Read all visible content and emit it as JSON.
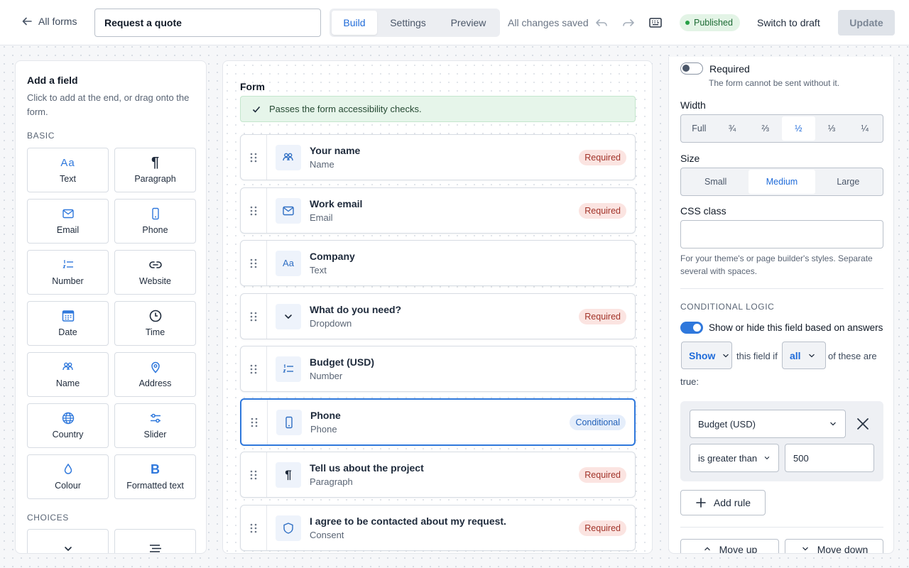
{
  "header": {
    "back_label": "All forms",
    "form_title": "Request a quote",
    "tabs": [
      {
        "label": "Build"
      },
      {
        "label": "Settings"
      },
      {
        "label": "Preview"
      }
    ],
    "saved_status": "All changes saved",
    "published_label": "Published",
    "switch_draft_label": "Switch to draft",
    "update_label": "Update"
  },
  "add_field": {
    "title": "Add a field",
    "description": "Click to add at the end, or drag onto the form.",
    "basic_heading": "BASIC",
    "choices_heading": "CHOICES",
    "basic": [
      {
        "label": "Text",
        "icon": "text-aa-icon"
      },
      {
        "label": "Paragraph",
        "icon": "pilcrow-icon"
      },
      {
        "label": "Email",
        "icon": "envelope-icon"
      },
      {
        "label": "Phone",
        "icon": "mobile-phone-icon"
      },
      {
        "label": "Number",
        "icon": "numbered-list-icon"
      },
      {
        "label": "Website",
        "icon": "link-icon"
      },
      {
        "label": "Date",
        "icon": "calendar-icon"
      },
      {
        "label": "Time",
        "icon": "clock-icon"
      },
      {
        "label": "Name",
        "icon": "people-icon"
      },
      {
        "label": "Address",
        "icon": "map-pin-icon"
      },
      {
        "label": "Country",
        "icon": "globe-icon"
      },
      {
        "label": "Slider",
        "icon": "sliders-icon"
      },
      {
        "label": "Colour",
        "icon": "droplet-icon"
      },
      {
        "label": "Formatted text",
        "icon": "bold-b-icon"
      }
    ]
  },
  "form": {
    "heading": "Form",
    "accessibility_message": "Passes the form accessibility checks.",
    "fields": [
      {
        "name": "Your name",
        "type": "Name",
        "badge": "Required",
        "icon": "people-icon"
      },
      {
        "name": "Work email",
        "type": "Email",
        "badge": "Required",
        "icon": "envelope-icon"
      },
      {
        "name": "Company",
        "type": "Text",
        "badge": "",
        "icon": "text-aa-icon"
      },
      {
        "name": "What do you need?",
        "type": "Dropdown",
        "badge": "Required",
        "icon": "chevron-down-icon"
      },
      {
        "name": "Budget (USD)",
        "type": "Number",
        "badge": "",
        "icon": "numbered-list-icon"
      },
      {
        "name": "Phone",
        "type": "Phone",
        "badge": "Conditional",
        "icon": "mobile-phone-icon"
      },
      {
        "name": "Tell us about the project",
        "type": "Paragraph",
        "badge": "Required",
        "icon": "pilcrow-icon"
      },
      {
        "name": "I agree to be contacted about my request.",
        "type": "Consent",
        "badge": "Required",
        "icon": "shield-icon"
      }
    ]
  },
  "settings": {
    "required_label": "Required",
    "required_hint": "The form cannot be sent without it.",
    "required_on": false,
    "width_label": "Width",
    "width_options": [
      "Full",
      "¾",
      "⅔",
      "½",
      "⅓",
      "¼"
    ],
    "width_selected": "½",
    "size_label": "Size",
    "size_options": [
      "Small",
      "Medium",
      "Large"
    ],
    "size_selected": "Medium",
    "css_label": "CSS class",
    "css_value": "",
    "css_hint": "For your theme's or page builder's styles. Separate several with spaces.",
    "conditional_heading": "CONDITIONAL LOGIC",
    "conditional_toggle_label": "Show or hide this field based on answers",
    "conditional_on": true,
    "action_value": "Show",
    "text_this_field_if": "this field if",
    "match_value": "all",
    "text_of_these_are": "of these are",
    "text_true": "true:",
    "rule": {
      "field": "Budget (USD)",
      "operator": "is greater than",
      "value": "500"
    },
    "add_rule_label": "Add rule",
    "move_up_label": "Move up",
    "move_down_label": "Move down"
  },
  "colors": {
    "accent": "#2f78dc",
    "required_badge": "#fbe4e1",
    "conditional_badge": "#e5eefb",
    "published": "#e3f4e6"
  }
}
